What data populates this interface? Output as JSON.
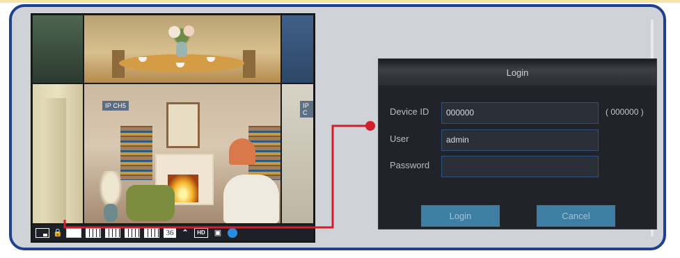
{
  "monitor": {
    "channel_labels": [
      "IP CH5",
      "IP C"
    ],
    "toolbar": {
      "icons": [
        "screen-icon",
        "lock-icon",
        "layout-1x2-icon",
        "layout-2x2-icon",
        "layout-3x3-icon",
        "layout-4x4-icon",
        "layout-5x5-icon",
        "chevron-up-icon",
        "snapshot-icon",
        "globe-icon"
      ],
      "layout_36_label": "36",
      "hd_label": "HD"
    }
  },
  "login_dialog": {
    "title": "Login",
    "device_id": {
      "label": "Device ID",
      "value": "000000",
      "hint": "( 000000 )"
    },
    "user": {
      "label": "User",
      "value": "admin"
    },
    "password": {
      "label": "Password",
      "value": ""
    },
    "login_button": "Login",
    "cancel_button": "Cancel"
  },
  "colors": {
    "frame_border": "#1f3f8f",
    "frame_bg": "#cfd2d6",
    "connector": "#d11f2b",
    "dialog_bg": "#20242a",
    "button_bg": "#3f7ea3"
  }
}
